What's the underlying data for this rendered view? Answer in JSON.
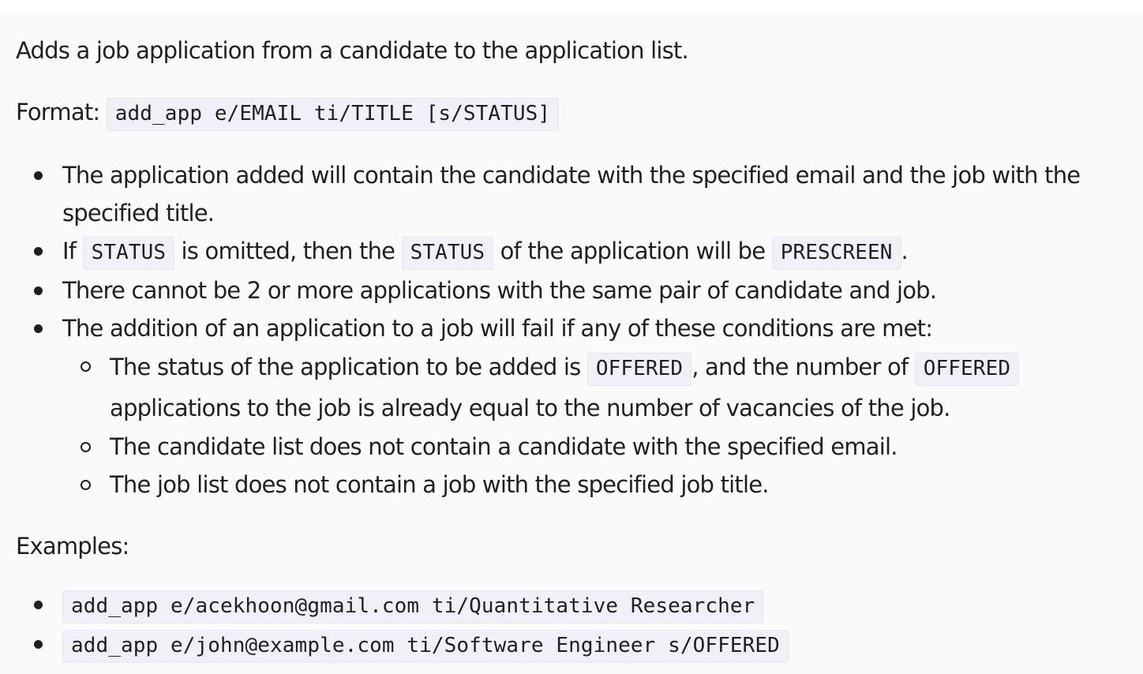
{
  "intro": "Adds a job application from a candidate to the application list.",
  "format": {
    "label": "Format:",
    "command": "add_app e/EMAIL ti/TITLE [s/STATUS]"
  },
  "notes": {
    "note1": "The application added will contain the candidate with the specified email and the job with the specified title.",
    "note2": {
      "t1": "If",
      "c1": "STATUS",
      "t2": "is omitted, then the",
      "c2": "STATUS",
      "t3": "of the application will be",
      "c3": "PRESCREEN",
      "t4": "."
    },
    "note3": "There cannot be 2 or more applications with the same pair of candidate and job.",
    "note4": "The addition of an application to a job will fail if any of these conditions are met:",
    "conditions": {
      "cond1": {
        "t1": "The status of the application to be added is",
        "c1": "OFFERED",
        "t2": ", and the number of",
        "c2": "OFFERED",
        "t3": "applications to the job is already equal to the number of vacancies of the job."
      },
      "cond2": "The candidate list does not contain a candidate with the specified email.",
      "cond3": "The job list does not contain a job with the specified job title."
    }
  },
  "examples": {
    "label": "Examples:",
    "items": [
      "add_app e/acekhoon@gmail.com ti/Quantitative Researcher",
      "add_app e/john@example.com ti/Software Engineer s/OFFERED"
    ]
  }
}
